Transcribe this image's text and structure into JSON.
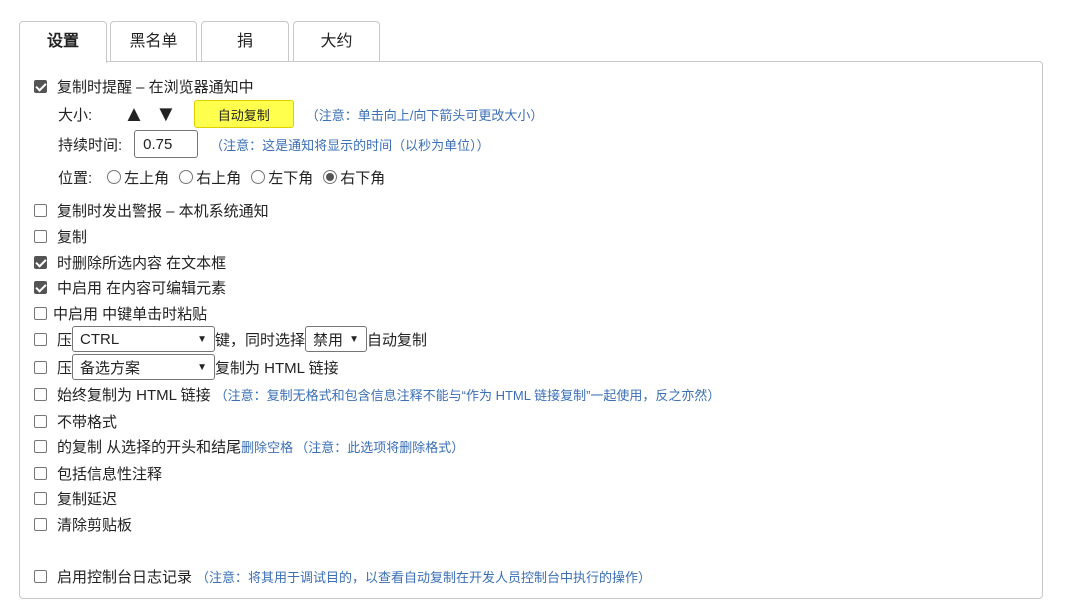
{
  "tabs": [
    "设置",
    "黑名单",
    "捐",
    "大约"
  ],
  "notify": {
    "label": "复制时提醒 – 在浏览器通知中",
    "checked": true,
    "size_label": "大小:",
    "up_arrow": "▲",
    "down_arrow": "▼",
    "autocopy_button": "自动复制",
    "size_note": "（注意：单击向上/向下箭头可更改大小）",
    "duration_label": "持续时间:",
    "duration_value": "0.75",
    "duration_note": "（注意：这是通知将显示的时间（以秒为单位））",
    "position_label": "位置:",
    "positions": [
      "左上角",
      "右上角",
      "左下角",
      "右下角"
    ],
    "selected_position": "右下角"
  },
  "options": [
    {
      "label": "复制时发出警报 – 本机系统通知",
      "checked": false
    },
    {
      "label": "复制",
      "checked": false
    },
    {
      "label": "时删除所选内容 在文本框",
      "checked": true
    },
    {
      "label": "中启用 在内容可编辑元素",
      "checked": true
    },
    {
      "label": "中启用 中键单击时粘贴",
      "checked": false
    }
  ],
  "modifier_row": {
    "prefix": "压",
    "key_select": "CTRL",
    "middle": "键，同时选择",
    "mode_select": "禁用",
    "suffix": "自动复制",
    "checked": false
  },
  "alt_row": {
    "prefix": "压",
    "alt_select": "备选方案",
    "suffix": "复制为 HTML 链接",
    "checked": false
  },
  "options2": [
    {
      "label": "始终复制为 HTML 链接",
      "note": "（注意：复制无格式和包含信息注释不能与“作为 HTML 链接复制”一起使用，反之亦然）",
      "checked": false
    },
    {
      "label": "不带格式",
      "note": "",
      "checked": false
    },
    {
      "label": "的复制 从选择的开头和结尾",
      "inline": "删除空格",
      "note": "（注意：此选项将删除格式）",
      "checked": false
    },
    {
      "label": "包括信息性注释",
      "note": "",
      "checked": false
    },
    {
      "label": "复制延迟",
      "note": "",
      "checked": false
    },
    {
      "label": "清除剪贴板",
      "note": "",
      "checked": false
    }
  ],
  "console": {
    "label": "启用控制台日志记录",
    "note": "（注意：将其用于调试目的，以查看自动复制在开发人员控制台中执行的操作）",
    "checked": false
  },
  "colors": {
    "accent_note": "#3b6fb6",
    "autocopy_yellow": "#ffff4d"
  }
}
